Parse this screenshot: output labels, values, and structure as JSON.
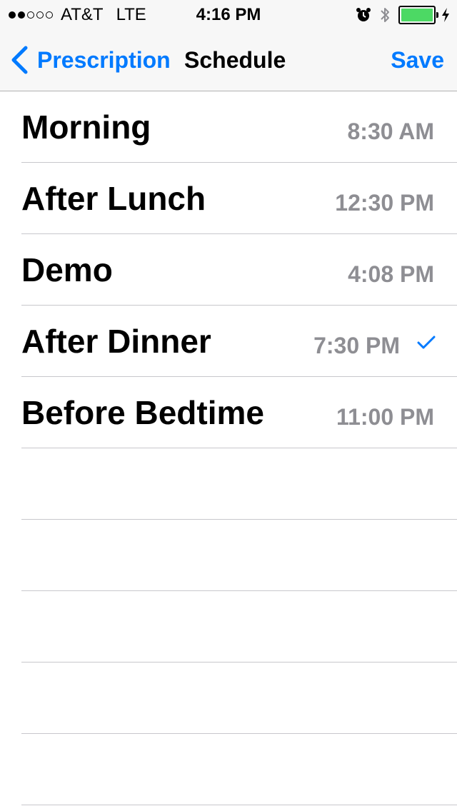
{
  "status_bar": {
    "signal_bars_filled": 2,
    "signal_bars_total": 5,
    "carrier": "AT&T",
    "network": "LTE",
    "time": "4:16 PM",
    "battery_level": 1.0,
    "battery_color": "#4cd964",
    "icons": [
      "alarm-icon",
      "bluetooth-icon",
      "battery-icon",
      "charging-bolt-icon"
    ]
  },
  "nav": {
    "back_label": "Prescription",
    "title": "Schedule",
    "save_label": "Save",
    "accent_color": "#007aff"
  },
  "schedule": [
    {
      "label": "Morning",
      "time": "8:30 AM",
      "checked": false
    },
    {
      "label": "After Lunch",
      "time": "12:30 PM",
      "checked": false
    },
    {
      "label": "Demo",
      "time": "4:08 PM",
      "checked": false
    },
    {
      "label": "After Dinner",
      "time": "7:30 PM",
      "checked": true
    },
    {
      "label": "Before Bedtime",
      "time": "11:00 PM",
      "checked": false
    }
  ]
}
